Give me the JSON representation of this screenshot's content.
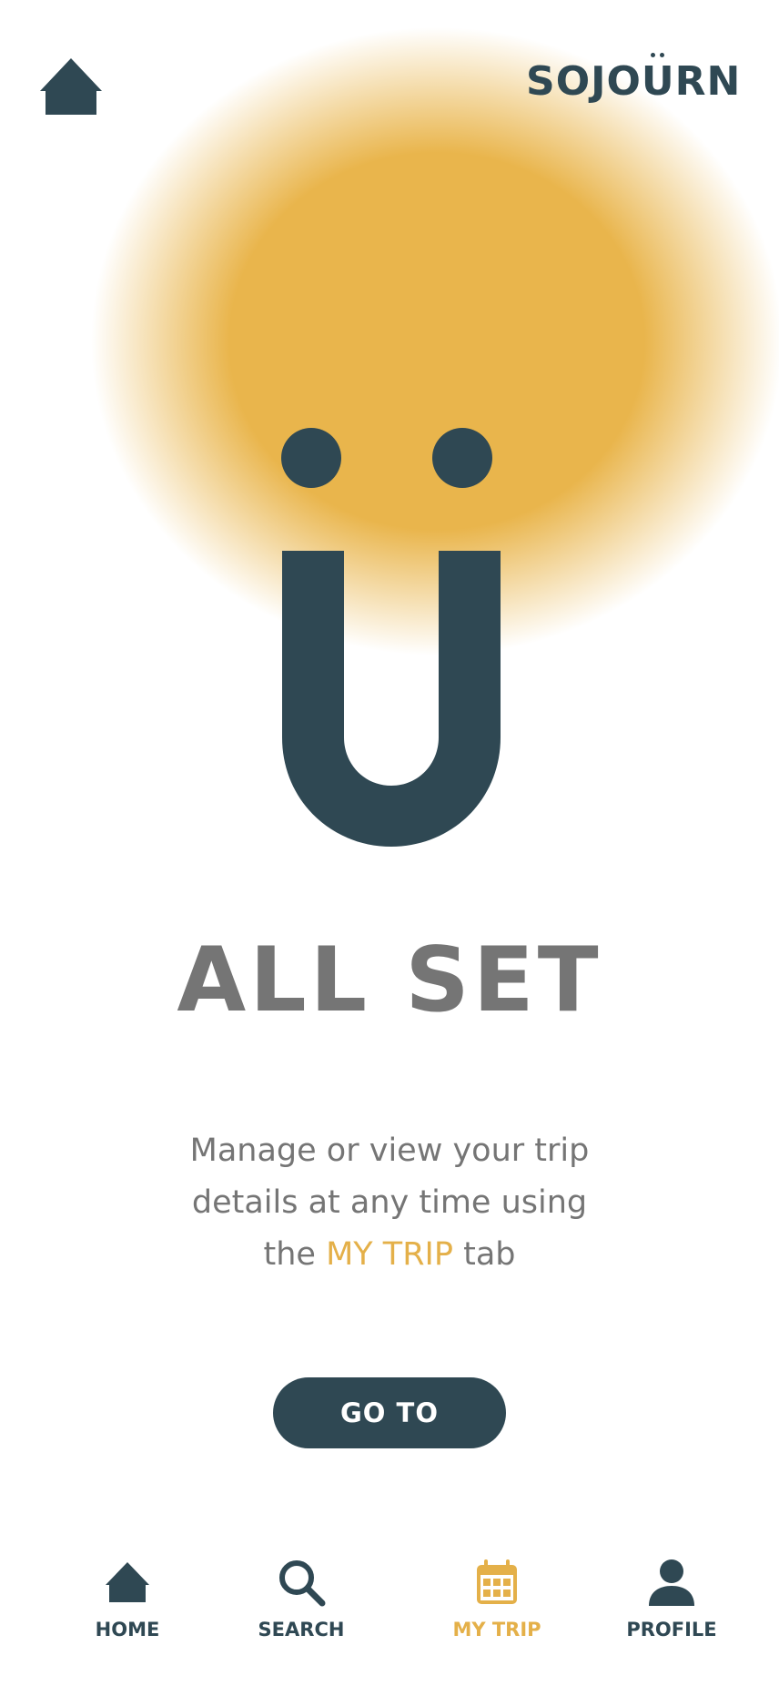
{
  "header": {
    "brand": "SOJOURN"
  },
  "main": {
    "title": "ALL SET",
    "description_pre": "Manage or view your trip details at any time using the",
    "description_highlight": "MY TRIP",
    "description_post": "tab",
    "cta_label": "GO TO"
  },
  "tabbar": {
    "items": [
      {
        "label": "HOME",
        "icon": "home-icon"
      },
      {
        "label": "SEARCH",
        "icon": "search-icon"
      },
      {
        "label": "MY TRIP",
        "icon": "calendar-icon",
        "active": true
      },
      {
        "label": "PROFILE",
        "icon": "user-icon"
      }
    ]
  },
  "colors": {
    "primary": "#2f4853",
    "accent": "#e4b049",
    "glow": "#e9b54c",
    "text_muted": "#757575",
    "background": "#ffffff"
  }
}
